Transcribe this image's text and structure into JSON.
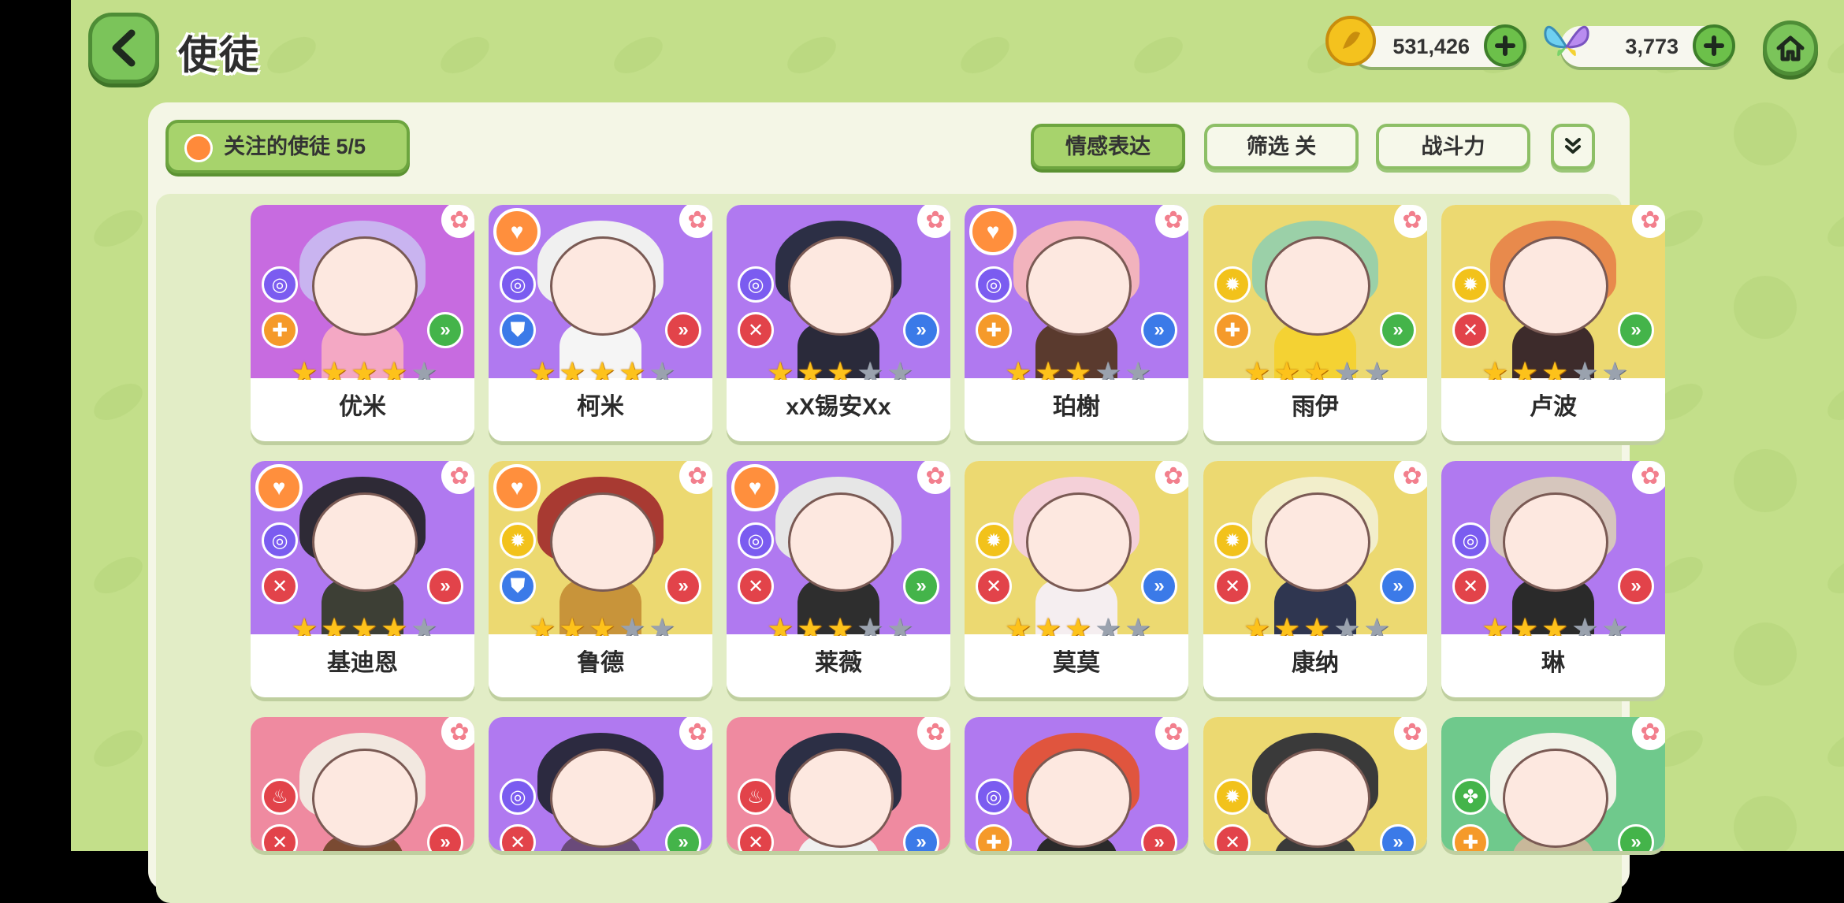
{
  "header": {
    "title": "使徒"
  },
  "currencies": {
    "coins": "531,426",
    "gems": "3,773"
  },
  "toolbar": {
    "follow_label": "关注的使徒  5/5",
    "emotion_label": "情感表达",
    "filter_label": "筛选 关",
    "power_label": "战斗力"
  },
  "colors": {
    "purple": "#b079f0",
    "yellow": "#ecd971",
    "pink": "#ef8aa0",
    "green": "#6fc98c",
    "accent_green": "#7bc45a"
  },
  "cards": [
    {
      "name": "优米",
      "bg": "#c76be0",
      "stars": 4,
      "fav": false,
      "element": "spiral-icon",
      "elementColor": "#7b5cf0",
      "klass": "cross-icon",
      "klassColor": "#f59a2a",
      "role": "chevron-icon",
      "roleColor": "#44b44a",
      "hair": "#c9b4f0",
      "body": "#f4a8c4"
    },
    {
      "name": "柯米",
      "bg": "#b079f0",
      "stars": 4,
      "fav": true,
      "element": "spiral-icon",
      "elementColor": "#7b5cf0",
      "klass": "shield-icon",
      "klassColor": "#3b7ae8",
      "role": "chevron-icon",
      "roleColor": "#e2434a",
      "hair": "#f0f0f0",
      "body": "#f5f5f5"
    },
    {
      "name": "xX锡安Xx",
      "bg": "#b079f0",
      "stars": 3,
      "fav": false,
      "element": "spiral-icon",
      "elementColor": "#7b5cf0",
      "klass": "swords-icon",
      "klassColor": "#e2434a",
      "role": "chevron-icon",
      "roleColor": "#3b7ae8",
      "hair": "#2c2f45",
      "body": "#2a2a3a"
    },
    {
      "name": "珀榭",
      "bg": "#b079f0",
      "stars": 3,
      "fav": true,
      "element": "spiral-icon",
      "elementColor": "#7b5cf0",
      "klass": "cross-icon",
      "klassColor": "#f59a2a",
      "role": "chevron-icon",
      "roleColor": "#3b7ae8",
      "hair": "#f2b3bd",
      "body": "#5a3a2e"
    },
    {
      "name": "雨伊",
      "bg": "#ecd971",
      "stars": 3,
      "fav": false,
      "element": "sun-icon",
      "elementColor": "#f2c21b",
      "klass": "cross-icon",
      "klassColor": "#f59a2a",
      "role": "chevron-icon",
      "roleColor": "#44b44a",
      "hair": "#9bd0a8",
      "body": "#f4d233"
    },
    {
      "name": "卢波",
      "bg": "#ecd971",
      "stars": 3,
      "fav": false,
      "element": "sun-icon",
      "elementColor": "#f2c21b",
      "klass": "swords-icon",
      "klassColor": "#e2434a",
      "role": "chevron-icon",
      "roleColor": "#44b44a",
      "hair": "#e88a4c",
      "body": "#3d2b2b"
    },
    {
      "name": "基迪恩",
      "bg": "#b079f0",
      "stars": 4,
      "fav": true,
      "element": "spiral-icon",
      "elementColor": "#7b5cf0",
      "klass": "swords-icon",
      "klassColor": "#e2434a",
      "role": "chevron-icon",
      "roleColor": "#e2434a",
      "hair": "#2e2a36",
      "body": "#3d3f35"
    },
    {
      "name": "鲁德",
      "bg": "#ecd971",
      "stars": 3,
      "fav": true,
      "element": "sun-icon",
      "elementColor": "#f2c21b",
      "klass": "shield-icon",
      "klassColor": "#3b7ae8",
      "role": "chevron-icon",
      "roleColor": "#e2434a",
      "hair": "#a83a32",
      "body": "#c8943a"
    },
    {
      "name": "莱薇",
      "bg": "#b079f0",
      "stars": 3,
      "fav": true,
      "element": "spiral-icon",
      "elementColor": "#7b5cf0",
      "klass": "swords-icon",
      "klassColor": "#e2434a",
      "role": "chevron-icon",
      "roleColor": "#44b44a",
      "hair": "#e6e6e6",
      "body": "#2e2e2e"
    },
    {
      "name": "莫莫",
      "bg": "#ecd971",
      "stars": 3,
      "fav": false,
      "element": "sun-icon",
      "elementColor": "#f2c21b",
      "klass": "swords-icon",
      "klassColor": "#e2434a",
      "role": "chevron-icon",
      "roleColor": "#3b7ae8",
      "hair": "#f4d0d8",
      "body": "#f5eef0"
    },
    {
      "name": "康纳",
      "bg": "#ecd971",
      "stars": 3,
      "fav": false,
      "element": "sun-icon",
      "elementColor": "#f2c21b",
      "klass": "swords-icon",
      "klassColor": "#e2434a",
      "role": "chevron-icon",
      "roleColor": "#3b7ae8",
      "hair": "#f2eecb",
      "body": "#2f3650"
    },
    {
      "name": "琳",
      "bg": "#b079f0",
      "stars": 3,
      "fav": false,
      "element": "spiral-icon",
      "elementColor": "#7b5cf0",
      "klass": "swords-icon",
      "klassColor": "#e2434a",
      "role": "chevron-icon",
      "roleColor": "#e2434a",
      "hair": "#d6c6bd",
      "body": "#2a2a2a"
    },
    {
      "name": "",
      "bg": "#ef8aa0",
      "stars": 0,
      "fav": false,
      "element": "flame-icon",
      "elementColor": "#e2434a",
      "klass": "swords-icon",
      "klassColor": "#e2434a",
      "role": "chevron-icon",
      "roleColor": "#e2434a",
      "hair": "#f2e8e0",
      "body": "#7a4a32"
    },
    {
      "name": "",
      "bg": "#b079f0",
      "stars": 0,
      "fav": false,
      "element": "spiral-icon",
      "elementColor": "#7b5cf0",
      "klass": "swords-icon",
      "klassColor": "#e2434a",
      "role": "chevron-icon",
      "roleColor": "#44b44a",
      "hair": "#2c2a40",
      "body": "#6a4a7a"
    },
    {
      "name": "",
      "bg": "#ef8aa0",
      "stars": 0,
      "fav": false,
      "element": "flame-icon",
      "elementColor": "#e2434a",
      "klass": "swords-icon",
      "klassColor": "#e2434a",
      "role": "chevron-icon",
      "roleColor": "#3b7ae8",
      "hair": "#2c2f45",
      "body": "#f0f0f0"
    },
    {
      "name": "",
      "bg": "#b079f0",
      "stars": 0,
      "fav": false,
      "element": "spiral-icon",
      "elementColor": "#7b5cf0",
      "klass": "cross-icon",
      "klassColor": "#f59a2a",
      "role": "chevron-icon",
      "roleColor": "#e2434a",
      "hair": "#e0553e",
      "body": "#2a2a2a"
    },
    {
      "name": "",
      "bg": "#ecd971",
      "stars": 0,
      "fav": false,
      "element": "sun-icon",
      "elementColor": "#f2c21b",
      "klass": "swords-icon",
      "klassColor": "#e2434a",
      "role": "chevron-icon",
      "roleColor": "#3b7ae8",
      "hair": "#3a3a3a",
      "body": "#3a3a3a"
    },
    {
      "name": "",
      "bg": "#6fc98c",
      "stars": 0,
      "fav": false,
      "element": "clover-icon",
      "elementColor": "#44b44a",
      "klass": "cross-icon",
      "klassColor": "#f59a2a",
      "role": "chevron-icon",
      "roleColor": "#44b44a",
      "hair": "#f2f2e8",
      "body": "#c8b89a"
    }
  ]
}
